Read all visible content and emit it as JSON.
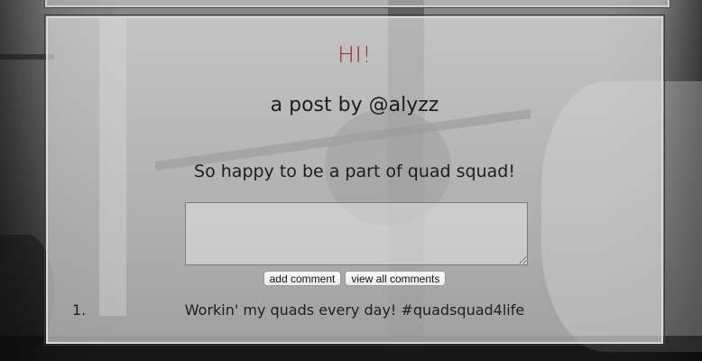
{
  "post": {
    "title": "HI!",
    "author_line": "a post by @alyzz",
    "body": "So happy to be a part of quad squad!",
    "title_color": "#9c2a3a"
  },
  "comment_form": {
    "value": "",
    "add_comment_label": "add comment",
    "view_all_label": "view all comments"
  },
  "comments": [
    {
      "number": "1.",
      "text": "Workin' my quads every day! #quadsquad4life"
    }
  ]
}
